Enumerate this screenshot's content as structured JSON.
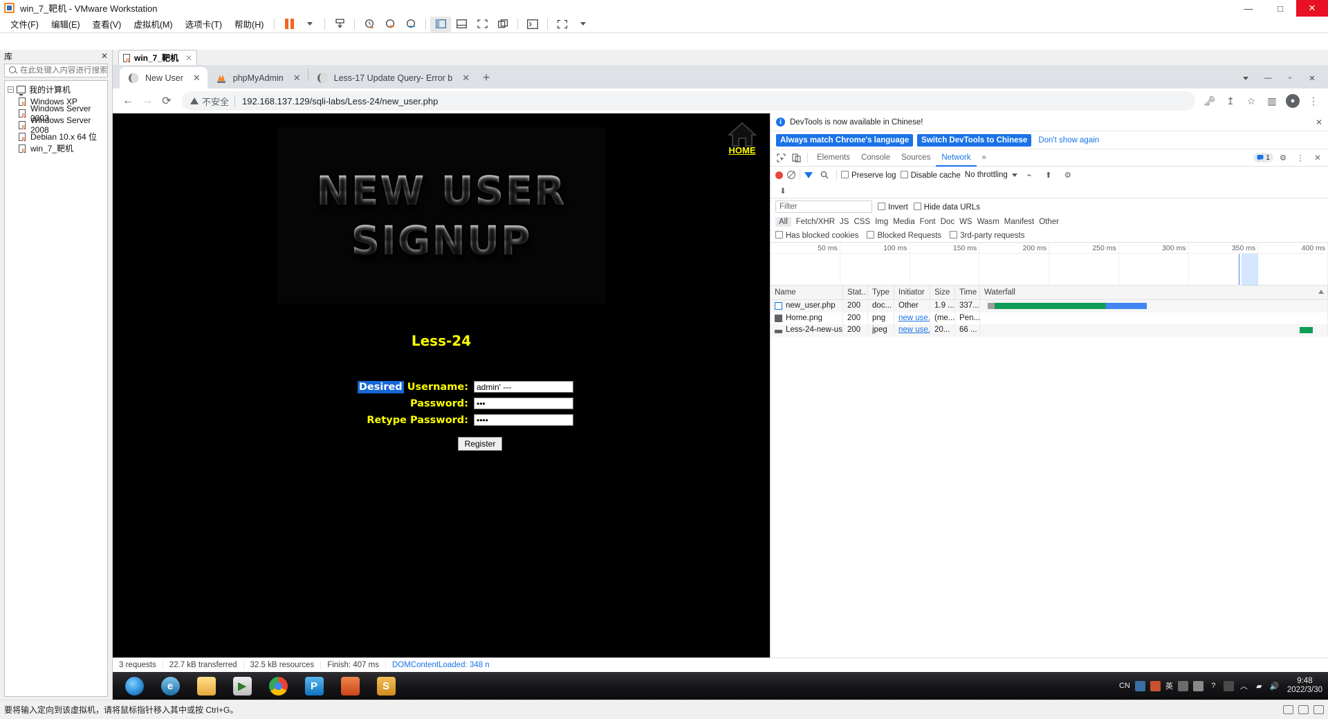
{
  "vmware": {
    "title": "win_7_靶机 - VMware Workstation",
    "window_buttons": [
      "—",
      "□",
      "✕"
    ],
    "menus": [
      "文件(F)",
      "编辑(E)",
      "查看(V)",
      "虚拟机(M)",
      "选项卡(T)",
      "帮助(H)"
    ],
    "library": {
      "header": "库",
      "close": "✕",
      "search_placeholder": "在此处键入内容进行搜索",
      "root": "我的计算机",
      "items": [
        "Windows XP",
        "Windows Server 2003",
        "Windows Server 2008",
        "Debian 10.x 64 位",
        "win_7_靶机"
      ]
    },
    "vm_tab": {
      "label": "win_7_靶机",
      "close": "✕"
    },
    "statusbar": {
      "text": "要将输入定向到该虚拟机，请将鼠标指针移入其中或按 Ctrl+G。"
    }
  },
  "chrome": {
    "tabs": [
      {
        "label": "New User",
        "icon": "globe-icon",
        "active": true,
        "close": "✕"
      },
      {
        "label": "phpMyAdmin",
        "icon": "phpmyadmin-icon",
        "active": false,
        "close": "✕"
      },
      {
        "label": "Less-17 Update Query- Error b",
        "icon": "globe-icon",
        "active": false,
        "close": "✕"
      }
    ],
    "new_tab": "+",
    "omnibox": {
      "security_label": "不安全",
      "url": "192.168.137.129/sqli-labs/Less-24/new_user.php"
    },
    "nav": {
      "back": "←",
      "forward": "→",
      "reload": "⟳"
    }
  },
  "page": {
    "home_label": "HOME",
    "banner_line1": "NEW USER",
    "banner_line2": "SIGNUP",
    "title": "Less-24",
    "form": {
      "username_label_selected": "Desired",
      "username_label_rest": "Username:",
      "username_value": "admin' ---",
      "password_label": "Password:",
      "password_value": "•••",
      "retype_label": "Retype Password:",
      "retype_value": "••••",
      "submit_label": "Register"
    }
  },
  "devtools": {
    "banner_text": "DevTools is now available in Chinese!",
    "banner_close": "✕",
    "btn_always_match": "Always match Chrome's language",
    "btn_switch": "Switch DevTools to Chinese",
    "btn_dont_show": "Don't show again",
    "tabs": [
      "Elements",
      "Console",
      "Sources",
      "Network"
    ],
    "active_tab": "Network",
    "tabs_overflow": "»",
    "issue_count": "1",
    "toolbar": {
      "preserve_log": "Preserve log",
      "disable_cache": "Disable cache",
      "throttling": "No throttling"
    },
    "filter_placeholder": "Filter",
    "invert": "Invert",
    "hide_data_urls": "Hide data URLs",
    "types": [
      "All",
      "Fetch/XHR",
      "JS",
      "CSS",
      "Img",
      "Media",
      "Font",
      "Doc",
      "WS",
      "Wasm",
      "Manifest",
      "Other"
    ],
    "has_blocked_cookies": "Has blocked cookies",
    "blocked_requests": "Blocked Requests",
    "third_party": "3rd-party requests",
    "timeline_ticks": [
      "50 ms",
      "100 ms",
      "150 ms",
      "200 ms",
      "250 ms",
      "300 ms",
      "350 ms",
      "400 ms"
    ],
    "columns": [
      "Name",
      "Stat..",
      "Type",
      "Initiator",
      "Size",
      "Time",
      "Waterfall"
    ],
    "rows": [
      {
        "name": "new_user.php",
        "icon": "doc-icon",
        "status": "200",
        "type": "doc...",
        "initiator": "Other",
        "size": "1.9 ...",
        "time": "337...",
        "wf_start": 1,
        "wf_width": 36
      },
      {
        "name": "Home.png",
        "icon": "image-icon",
        "status": "200",
        "type": "png",
        "initiator": "new use...",
        "size": "(me...",
        "time": "Pen...",
        "wf_start": 86,
        "wf_width": 2
      },
      {
        "name": "Less-24-new-use...",
        "icon": "jpeg-icon",
        "status": "200",
        "type": "jpeg",
        "initiator": "new use...",
        "size": "20...",
        "time": "66 ...",
        "wf_start": 94,
        "wf_width": 4
      }
    ],
    "status": {
      "requests": "3 requests",
      "transferred": "22.7 kB transferred",
      "resources": "32.5 kB resources",
      "finish": "Finish: 407 ms",
      "dcl": "DOMContentLoaded: 348 n"
    }
  },
  "guest_taskbar": {
    "items": [
      {
        "name": "start-button",
        "label": "",
        "color": "#2f8fd8"
      },
      {
        "name": "internet-explorer",
        "label": "e",
        "color": "#2a7fbd"
      },
      {
        "name": "file-explorer",
        "label": "",
        "color": "#f2c14e"
      },
      {
        "name": "media-player",
        "label": "▶",
        "color": "#3d8f3d"
      },
      {
        "name": "chrome",
        "label": "",
        "color": "#4285f4"
      },
      {
        "name": "phpstudy",
        "label": "P",
        "color": "#1f8fd8"
      },
      {
        "name": "sublime-alt",
        "label": "",
        "color": "#d95f2b"
      },
      {
        "name": "sublime-text",
        "label": "S",
        "color": "#e09b2d"
      }
    ],
    "tray": {
      "input_method": "CN",
      "lang": "英",
      "time": "9:48",
      "date": "2022/3/30"
    }
  }
}
